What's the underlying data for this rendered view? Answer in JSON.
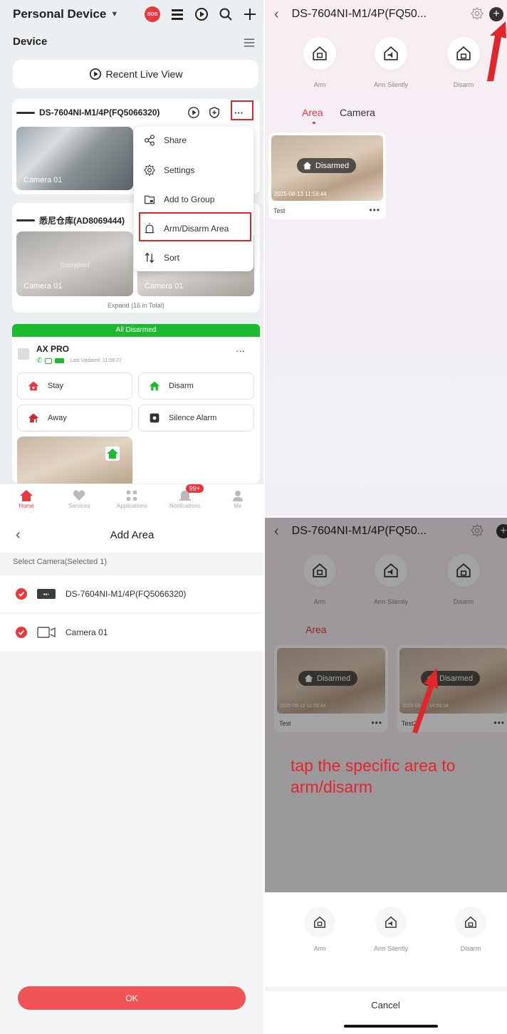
{
  "colors": {
    "accent": "#e83a3f",
    "green_status": "#1cba2e",
    "annotation_red": "#e0262b"
  },
  "home": {
    "title": "Personal Device",
    "sos": "SOS",
    "section_title": "Device",
    "recent_live_view": "Recent Live View",
    "device1": {
      "name": "DS-7604NI-M1/4P(FQ5066320)",
      "camera": "Camera 01"
    },
    "menu": {
      "items": [
        {
          "label": "Share",
          "icon": "share-icon"
        },
        {
          "label": "Settings",
          "icon": "gear-icon"
        },
        {
          "label": "Add to Group",
          "icon": "folder-add-icon"
        },
        {
          "label": "Arm/Disarm Area",
          "icon": "alarm-icon"
        },
        {
          "label": "Sort",
          "icon": "sort-icon"
        }
      ]
    },
    "device2": {
      "name": "悉尼仓库(AD8069444)",
      "camera_a": "Camera 01",
      "encrypted": "Encrypted",
      "camera_b": "Camera 01",
      "expand": "Expand (16 in Total)"
    },
    "axpro": {
      "status": "All Disarmed",
      "name": "AX PRO",
      "last_updated": "Last Updated: 11:59:27",
      "buttons": {
        "stay": "Stay",
        "disarm": "Disarm",
        "away": "Away",
        "silence": "Silence Alarm"
      }
    },
    "tabs": [
      {
        "label": "Home",
        "icon": "home-icon"
      },
      {
        "label": "Services",
        "icon": "heart-icon"
      },
      {
        "label": "Applications",
        "icon": "grid-icon"
      },
      {
        "label": "Notifications",
        "icon": "bell-icon"
      },
      {
        "label": "Me",
        "icon": "person-icon"
      }
    ],
    "notif_badge": "99+"
  },
  "area_page": {
    "title": "DS-7604NI-M1/4P(FQ50...",
    "actions": {
      "arm": "Arm",
      "arm_silently": "Arm Silently",
      "disarm": "Disarm"
    },
    "tabs": {
      "area": "Area",
      "camera": "Camera"
    },
    "card": {
      "status": "Disarmed",
      "timestamp": "2025-08-13 11:59:44",
      "name": "Test"
    }
  },
  "add_area": {
    "title": "Add Area",
    "subtitle": "Select Camera(Selected 1)",
    "rows": {
      "device": "DS-7604NI-M1/4P(FQ5066320)",
      "camera": "Camera 01"
    },
    "ok": "OK"
  },
  "sheet_page": {
    "title": "DS-7604NI-M1/4P(FQ50...",
    "actions": {
      "arm": "Arm",
      "arm_silently": "Arm Silently",
      "disarm": "Disarm"
    },
    "tab_area": "Area",
    "cards": [
      {
        "status": "Disarmed",
        "timestamp": "2025-08-13 11:59:44",
        "name": "Test"
      },
      {
        "status": "Disarmed",
        "timestamp": "2025-08-13 14:58:34",
        "name": "Test2"
      }
    ],
    "sheet_actions": {
      "arm": "Arm",
      "arm_silently": "Arm Silently",
      "disarm": "Disarm"
    },
    "cancel": "Cancel"
  },
  "annotation": "tap the specific area to arm/disarm"
}
